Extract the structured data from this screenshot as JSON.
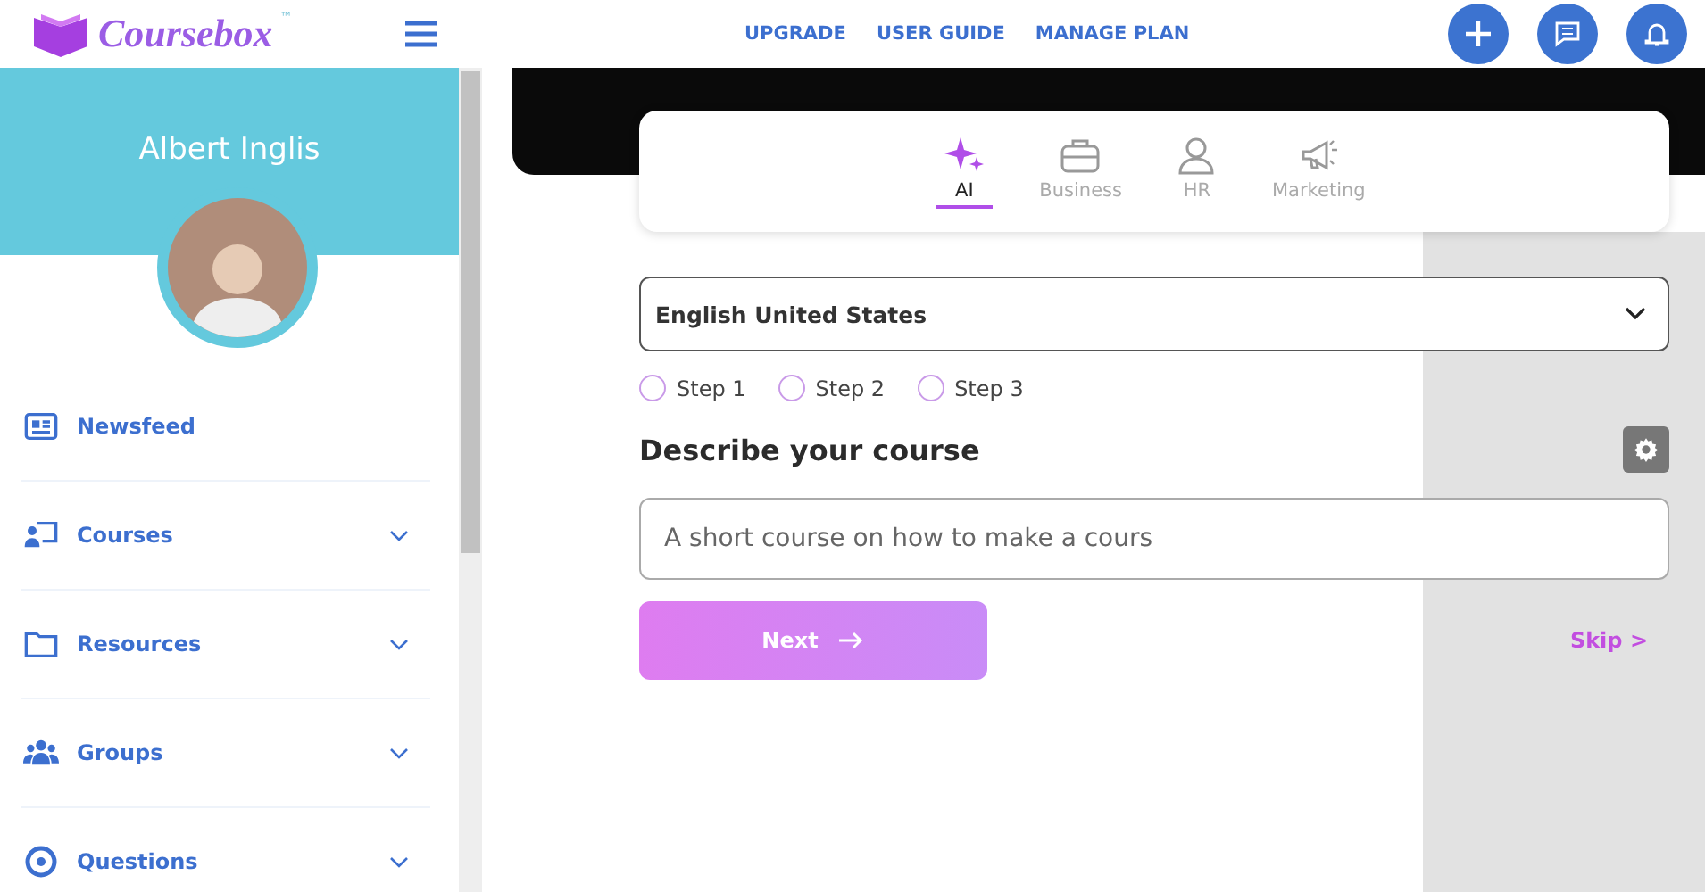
{
  "header": {
    "logo_text": "Coursebox",
    "logo_mark": "™",
    "nav_links": [
      "UPGRADE",
      "USER GUIDE",
      "MANAGE PLAN"
    ]
  },
  "sidebar": {
    "user_name": "Albert Inglis",
    "items": [
      {
        "label": "Newsfeed",
        "kind": "link"
      },
      {
        "label": "Courses",
        "kind": "dropdown"
      },
      {
        "label": "Resources",
        "kind": "dropdown"
      },
      {
        "label": "Groups",
        "kind": "dropdown"
      },
      {
        "label": "Questions",
        "kind": "dropdown"
      }
    ]
  },
  "category_tabs": [
    {
      "label": "AI",
      "selected": true
    },
    {
      "label": "Business",
      "selected": false
    },
    {
      "label": "HR",
      "selected": false
    },
    {
      "label": "Marketing",
      "selected": false
    }
  ],
  "language_select": {
    "value": "English United States"
  },
  "steps": [
    {
      "label": "Step 1",
      "selected": false
    },
    {
      "label": "Step 2",
      "selected": false
    },
    {
      "label": "Step 3",
      "selected": false
    }
  ],
  "prompt": {
    "heading": "Describe your course",
    "value": "A short course on how to make a cours"
  },
  "next_button": "Next",
  "skip_link": "Skip >"
}
